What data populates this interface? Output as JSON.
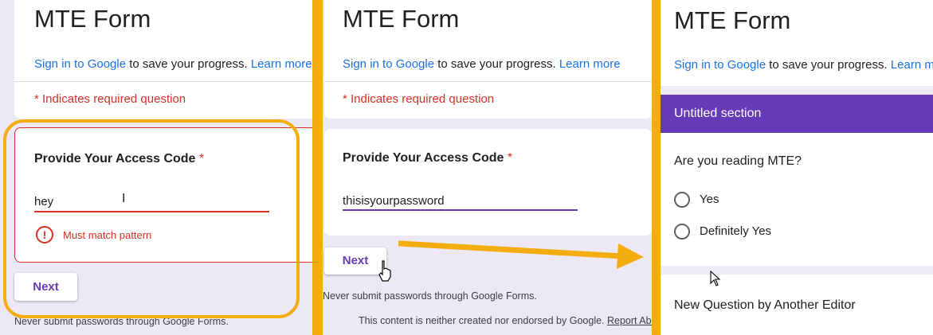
{
  "form_title": "MTE Form",
  "signin": {
    "link_text": "Sign in to Google",
    "middle_text": " to save your progress. ",
    "learn_more": "Learn more"
  },
  "required_note": "* Indicates required question",
  "question": {
    "title": "Provide Your Access Code",
    "required_mark": "*"
  },
  "panel1": {
    "answer": "hey",
    "error": "Must match pattern"
  },
  "panel2": {
    "answer": "thisisyourpassword"
  },
  "next_label": "Next",
  "password_warning": "Never submit passwords through Google Forms.",
  "disclaimer": "This content is neither created nor endorsed by Google.",
  "report_abuse": "Report Abuse",
  "panel3": {
    "section_title": "Untitled section",
    "question": "Are you reading MTE?",
    "options": [
      "Yes",
      "Definitely Yes"
    ],
    "next_question": "New Question by Another Editor"
  },
  "colors": {
    "accent": "#673ab7",
    "error": "#d93025",
    "highlight": "#f4ad0f",
    "link": "#1a73e8"
  }
}
